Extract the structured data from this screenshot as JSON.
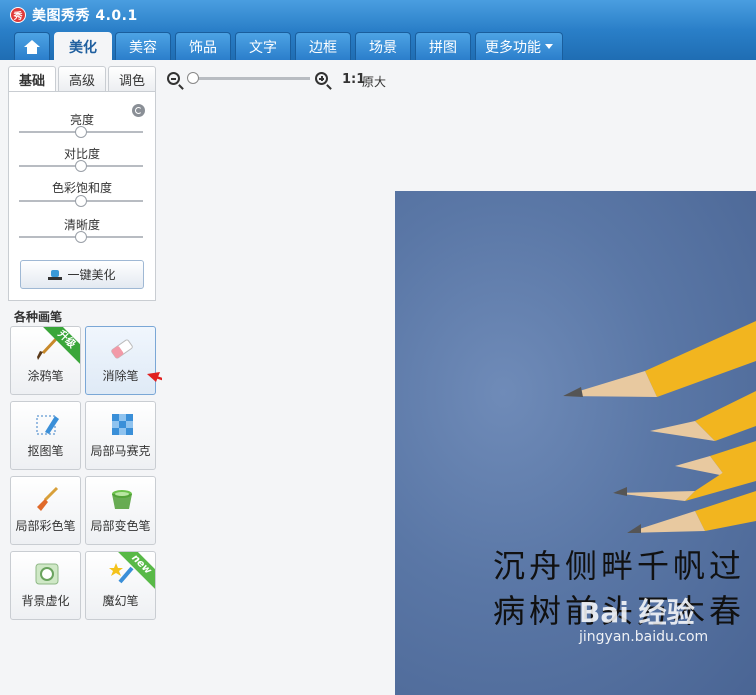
{
  "app": {
    "logo_char": "秀",
    "title": "美图秀秀 4.0.1"
  },
  "tabs": [
    {
      "label": "",
      "icon": "home-icon"
    },
    {
      "label": "美化"
    },
    {
      "label": "美容"
    },
    {
      "label": "饰品"
    },
    {
      "label": "文字"
    },
    {
      "label": "边框"
    },
    {
      "label": "场景"
    },
    {
      "label": "拼图"
    },
    {
      "label": "更多功能"
    }
  ],
  "subtabs": [
    {
      "label": "基础"
    },
    {
      "label": "高级"
    },
    {
      "label": "调色"
    }
  ],
  "sliders": [
    {
      "label": "亮度",
      "value": 0.5
    },
    {
      "label": "对比度",
      "value": 0.5
    },
    {
      "label": "色彩饱和度",
      "value": 0.5
    },
    {
      "label": "清晰度",
      "value": 0.5
    }
  ],
  "oneclick_label": "一键美化",
  "brushes_section": {
    "title": "各种画笔"
  },
  "brushes": [
    {
      "label": "涂鸦笔",
      "ribbon": "升级"
    },
    {
      "label": "消除笔"
    },
    {
      "label": "抠图笔"
    },
    {
      "label": "局部马赛克"
    },
    {
      "label": "局部彩色笔"
    },
    {
      "label": "局部变色笔"
    },
    {
      "label": "背景虚化"
    },
    {
      "label": "魔幻笔",
      "ribbon": "new"
    }
  ],
  "toolbar": {
    "ratio": "1:1",
    "original_size": "原大",
    "zoom": 0
  },
  "photo": {
    "poem_line1": "沉舟侧畔千帆过",
    "poem_line2": "病树前头万木春",
    "watermark": "Bai 经验",
    "watermark_url": "jingyan.baidu.com"
  },
  "colors": {
    "accent": "#2a7fc8",
    "arrow": "#e02020"
  }
}
